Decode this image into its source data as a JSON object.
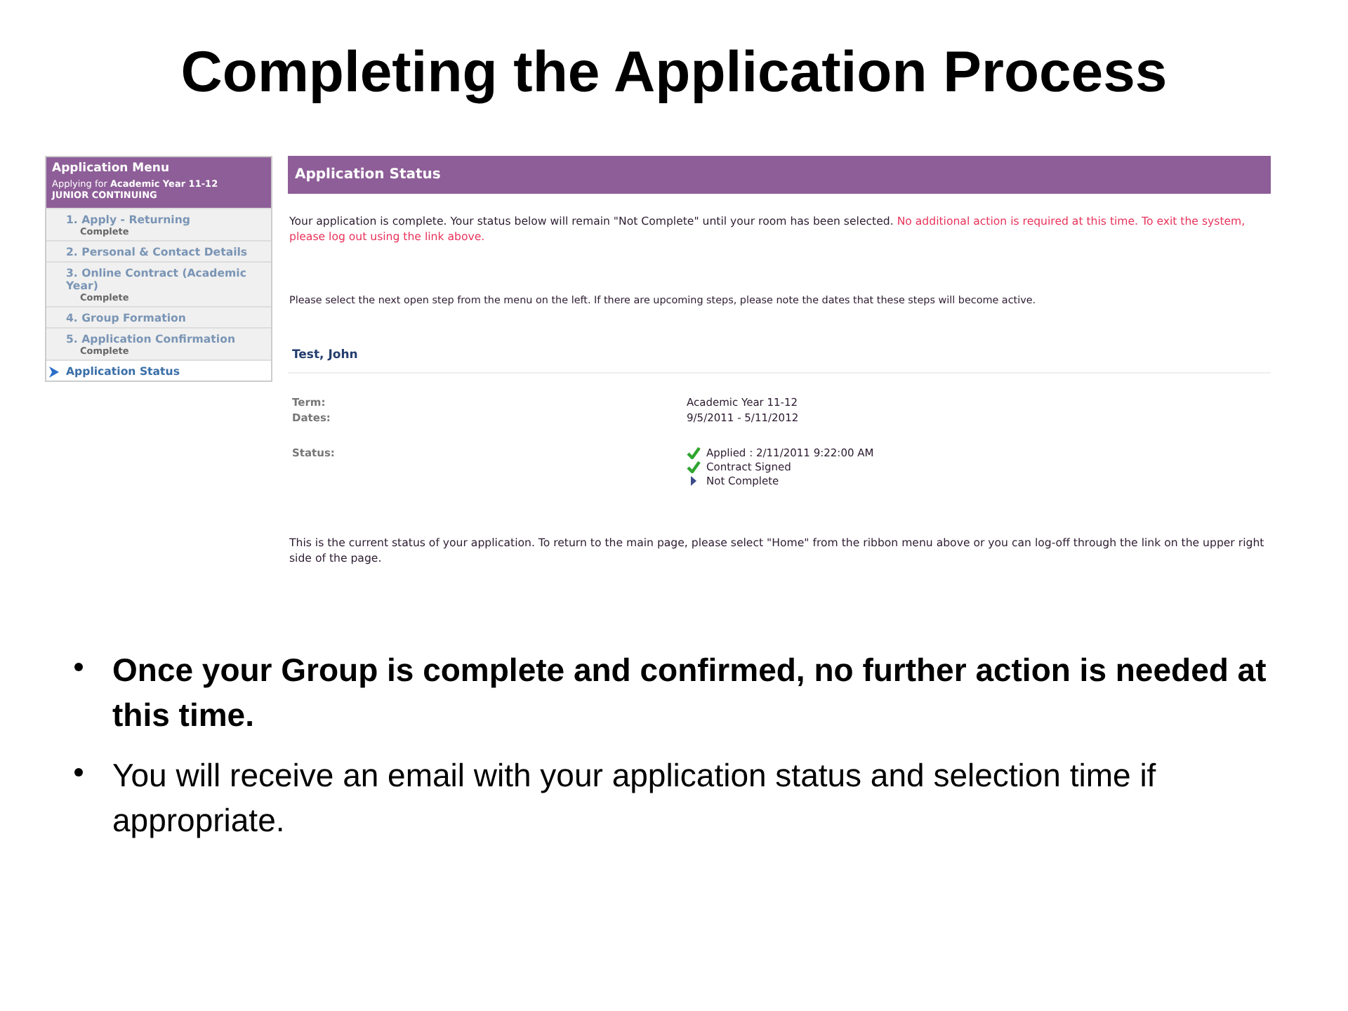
{
  "slide_title": "Completing the Application Process",
  "menu": {
    "title": "Application Menu",
    "applying_prefix": "Applying for",
    "applying_term": "Academic Year 11-12",
    "applying_group": "JUNIOR CONTINUING",
    "items": [
      {
        "label": "1. Apply - Returning",
        "status": "Complete",
        "selected": false
      },
      {
        "label": "2. Personal & Contact Details",
        "selected": false
      },
      {
        "label": "3. Online Contract (Academic Year)",
        "status": "Complete",
        "selected": false
      },
      {
        "label": "4. Group Formation",
        "selected": false
      },
      {
        "label": "5. Application Confirmation",
        "status": "Complete",
        "selected": false
      },
      {
        "label": "Application Status",
        "selected": true
      }
    ]
  },
  "panel": {
    "title": "Application Status",
    "message": "Your application is complete.  Your status below will remain \"Not Complete\" until your room has been selected.",
    "notice": "No additional action is required at this time.  To exit the system, please log out using the link above.",
    "instruction": "Please select the next open step from the menu on the left. If there are upcoming steps, please note the dates that these steps will become active.",
    "name": "Test, John",
    "fields": [
      {
        "label": "Term:",
        "value": "Academic Year 11-12"
      },
      {
        "label": "Dates:",
        "value": "9/5/2011 - 5/11/2012"
      }
    ],
    "status_label": "Status:",
    "statuses": [
      {
        "kind": "done",
        "text": "Applied : 2/11/2011 9:22:00 AM"
      },
      {
        "kind": "done",
        "text": "Contract Signed"
      },
      {
        "kind": "pending",
        "text": "Not Complete"
      }
    ],
    "footer": "This is the current status of your application. To return to the main page, please select \"Home\" from the ribbon menu above or you can log-off through the link on the upper right side of the page."
  },
  "bullets": [
    {
      "text": "Once your Group is complete and confirmed, no further action is needed at this time.",
      "bold": true
    },
    {
      "text": "You will receive an email with your application status and selection time if appropriate.",
      "bold": false
    }
  ]
}
